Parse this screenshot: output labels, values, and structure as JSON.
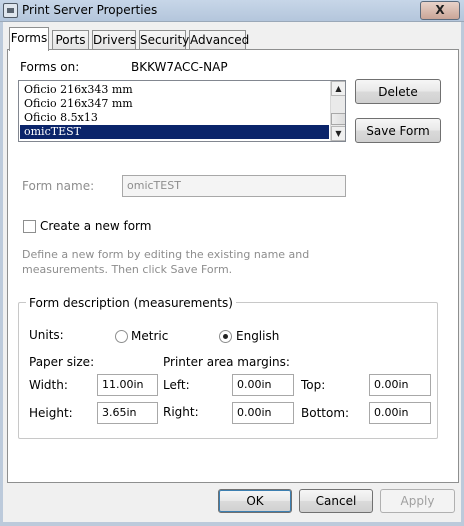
{
  "window": {
    "title": "Print Server Properties",
    "close_glyph": "X"
  },
  "tabs": [
    {
      "label": "Forms",
      "active": true
    },
    {
      "label": "Ports",
      "active": false
    },
    {
      "label": "Drivers",
      "active": false
    },
    {
      "label": "Security",
      "active": false
    },
    {
      "label": "Advanced",
      "active": false
    }
  ],
  "forms_on": {
    "label": "Forms on:",
    "server": "BKKW7ACC-NAP"
  },
  "form_list": {
    "items": [
      "Oficio 216x343 mm",
      "Oficio 216x347 mm",
      "Oficio 8.5x13",
      "omicTEST"
    ],
    "selected": "omicTEST"
  },
  "buttons": {
    "delete": "Delete",
    "save_form": "Save Form",
    "ok": "OK",
    "cancel": "Cancel",
    "apply": "Apply"
  },
  "form_name": {
    "label": "Form name:",
    "value": "omicTEST"
  },
  "create_new_form": {
    "label": "Create a new form",
    "checked": false
  },
  "hint": {
    "line1": "Define a new form by editing the existing name and",
    "line2": "measurements. Then click Save Form."
  },
  "form_description": {
    "title": "Form description (measurements)",
    "units_label": "Units:",
    "metric_label": "Metric",
    "english_label": "English",
    "selected_unit": "English",
    "paper_size_label": "Paper size:",
    "margins_label": "Printer area margins:",
    "width_label": "Width:",
    "width_value": "11.00in",
    "height_label": "Height:",
    "height_value": "3.65in",
    "left_label": "Left:",
    "left_value": "0.00in",
    "right_label": "Right:",
    "right_value": "0.00in",
    "top_label": "Top:",
    "top_value": "0.00in",
    "bottom_label": "Bottom:",
    "bottom_value": "0.00in"
  },
  "icons": {
    "window": "printer-icon",
    "scroll_up": "scroll-up-arrow-icon",
    "scroll_down": "scroll-down-arrow-icon"
  },
  "colors": {
    "selection": "#0a246a",
    "titlebar": "#c7d6e8",
    "close_button": "#c9a597"
  }
}
